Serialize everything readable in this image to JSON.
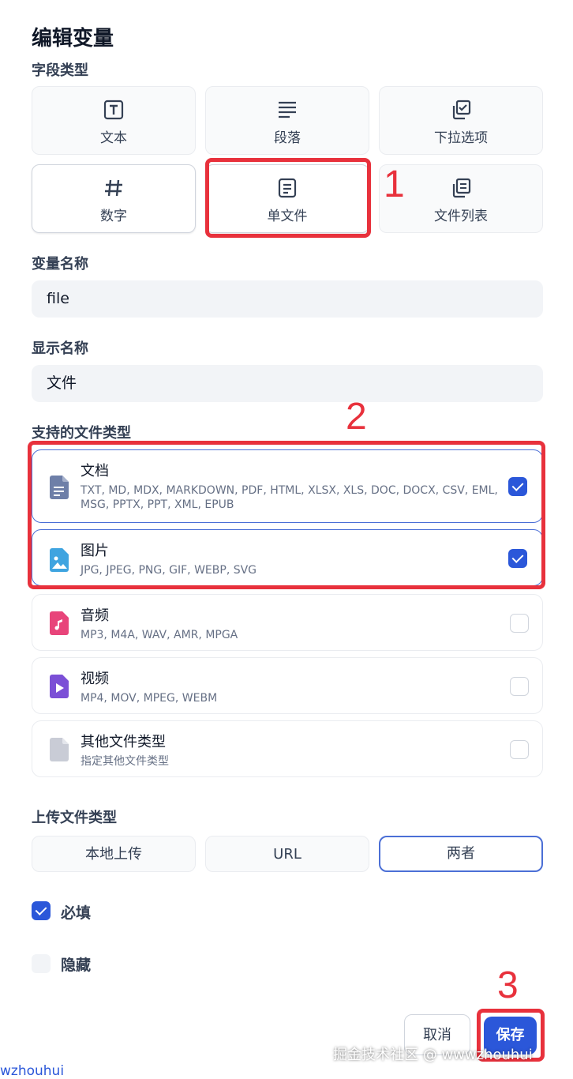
{
  "dialog": {
    "title": "编辑变量",
    "field_type_label": "字段类型",
    "field_types": [
      {
        "label": "文本",
        "icon": "text-icon"
      },
      {
        "label": "段落",
        "icon": "paragraph-icon"
      },
      {
        "label": "下拉选项",
        "icon": "dropdown-icon"
      },
      {
        "label": "数字",
        "icon": "hash-icon"
      },
      {
        "label": "单文件",
        "icon": "single-file-icon"
      },
      {
        "label": "文件列表",
        "icon": "file-list-icon"
      }
    ],
    "var_name_label": "变量名称",
    "var_name_value": "file",
    "display_name_label": "显示名称",
    "display_name_value": "文件",
    "supported_types_label": "支持的文件类型",
    "file_types": [
      {
        "name": "文档",
        "desc": "TXT, MD, MDX, MARKDOWN, PDF, HTML, XLSX, XLS, DOC, DOCX, CSV, EML, MSG, PPTX, PPT, XML, EPUB",
        "checked": true,
        "color": "#6e7fa8",
        "icon": "document-icon"
      },
      {
        "name": "图片",
        "desc": "JPG, JPEG, PNG, GIF, WEBP, SVG",
        "checked": true,
        "color": "#3fa4e0",
        "icon": "image-icon"
      },
      {
        "name": "音频",
        "desc": "MP3, M4A, WAV, AMR, MPGA",
        "checked": false,
        "color": "#e8447a",
        "icon": "audio-icon"
      },
      {
        "name": "视频",
        "desc": "MP4, MOV, MPEG, WEBM",
        "checked": false,
        "color": "#7b4fd6",
        "icon": "video-icon"
      },
      {
        "name": "其他文件类型",
        "desc": "指定其他文件类型",
        "checked": false,
        "color": "#c9ccd6",
        "icon": "other-file-icon"
      }
    ],
    "upload_type_label": "上传文件类型",
    "upload_options": [
      "本地上传",
      "URL",
      "两者"
    ],
    "upload_selected": "两者",
    "required_label": "必填",
    "required_checked": true,
    "hidden_label": "隐藏",
    "hidden_checked": false,
    "cancel_label": "取消",
    "save_label": "保存"
  },
  "annotations": {
    "one": "1",
    "two": "2",
    "three": "3",
    "accent": "#e8313c"
  },
  "watermark": {
    "text": "掘金技术社区 @ wwwzhouhui",
    "bottom_left": "wzhouhui"
  }
}
